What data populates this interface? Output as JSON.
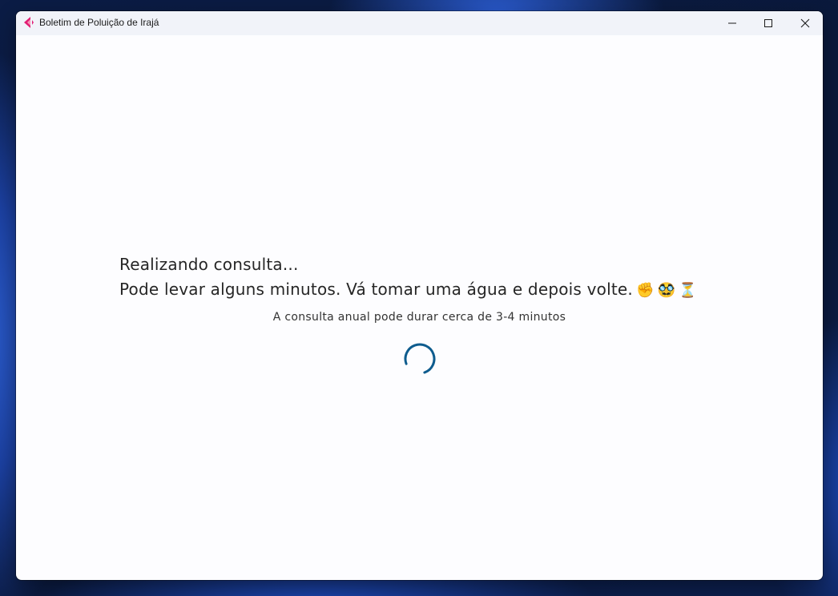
{
  "window": {
    "title": "Boletim de Poluição de Irajá"
  },
  "loading": {
    "line1": "Realizando consulta...",
    "line2": "Pode levar alguns minutos. Vá tomar uma água e depois volte.",
    "emojis": [
      "✊",
      "🥸",
      "⏳"
    ],
    "note": "A consulta anual pode durar cerca de 3-4 minutos"
  },
  "colors": {
    "spinner": "#0e5c8e",
    "app_icon_primary": "#e11d74",
    "app_icon_secondary": "#f59ab8"
  },
  "icons": {
    "app": "app-logo-icon",
    "minimize": "minimize-icon",
    "maximize": "maximize-icon",
    "close": "close-icon",
    "spinner": "loading-spinner-icon"
  }
}
